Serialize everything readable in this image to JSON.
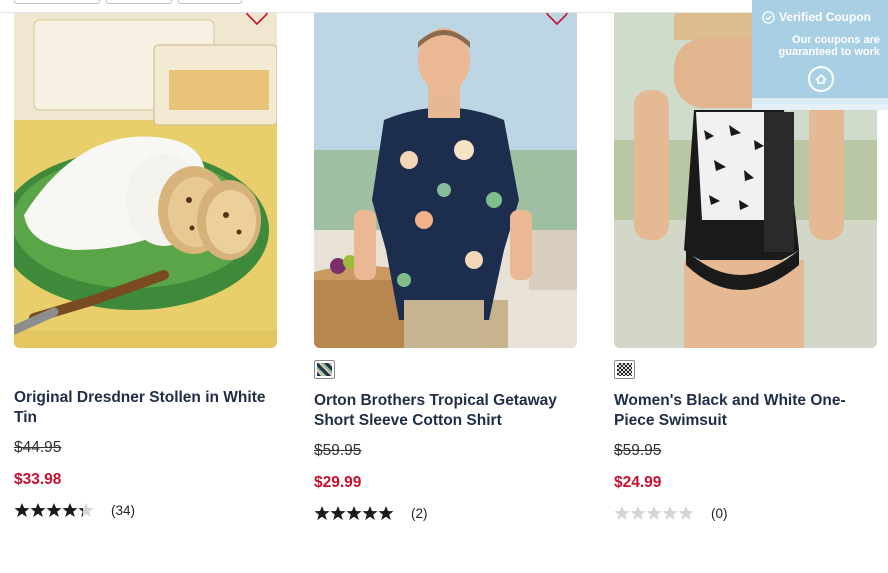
{
  "products": [
    {
      "name": "Original Dresdner Stollen in White Tin",
      "was_price": "$44.95",
      "sale_price": "$33.98",
      "rating": 4.3,
      "review_count": "(34)"
    },
    {
      "name": "Orton Brothers Tropical Getaway Short Sleeve Cotton Shirt",
      "was_price": "$59.95",
      "sale_price": "$29.99",
      "rating": 5,
      "review_count": "(2)"
    },
    {
      "name": "Women's Black and White One-Piece Swimsuit",
      "was_price": "$59.95",
      "sale_price": "$24.99",
      "rating": 0,
      "review_count": "(0)"
    }
  ],
  "coupon": {
    "title": "Verified Coupon",
    "text": "Our coupons are guaranteed to work"
  },
  "colors": {
    "sale": "#c8102e",
    "title": "#1f2d47",
    "star": "#1a1a1a",
    "coupon_bg": "#a9cfe4"
  },
  "icons": [
    "heart-icon",
    "star-icon",
    "check-badge-icon",
    "coupon-logo-icon"
  ]
}
